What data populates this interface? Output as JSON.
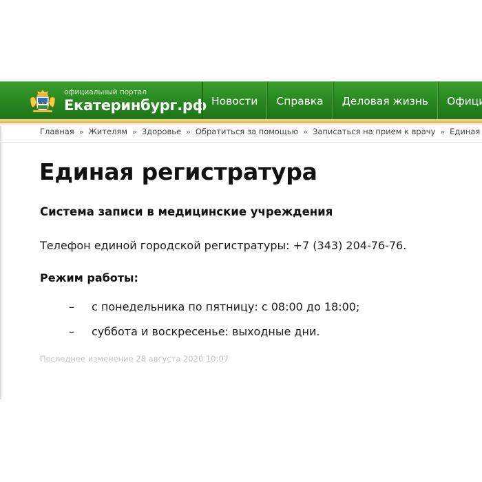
{
  "header": {
    "brand_subtitle": "официальный портал",
    "brand_title": "Екатеринбург.рф",
    "nav": [
      {
        "label": "Новости"
      },
      {
        "label": "Справка"
      },
      {
        "label": "Деловая жизнь"
      },
      {
        "label": "Официал"
      }
    ],
    "colors": {
      "nav_green": "#2a8a22",
      "gold_strip": "#e8c65e"
    }
  },
  "breadcrumb": {
    "items": [
      {
        "label": "Главная"
      },
      {
        "label": "Жителям"
      },
      {
        "label": "Здоровье"
      },
      {
        "label": "Обратиться за помощью"
      },
      {
        "label": "Записаться на прием к врачу"
      },
      {
        "label": "Единая регис"
      }
    ],
    "separator": "»"
  },
  "content": {
    "title": "Единая регистратура",
    "subtitle": "Система записи в медицинские учреждения",
    "phone_text": "Телефон единой городской регистратуры: +7 (343) 204-76-76.",
    "hours_title": "Режим работы:",
    "hours": [
      {
        "dash": "–",
        "text": "с понедельника по пятницу: с 08:00 до 18:00;"
      },
      {
        "dash": "–",
        "text": "суббота и воскресенье: выходные дни."
      }
    ],
    "last_modified": "Последнее изменение 28 августа 2020 10:07"
  }
}
